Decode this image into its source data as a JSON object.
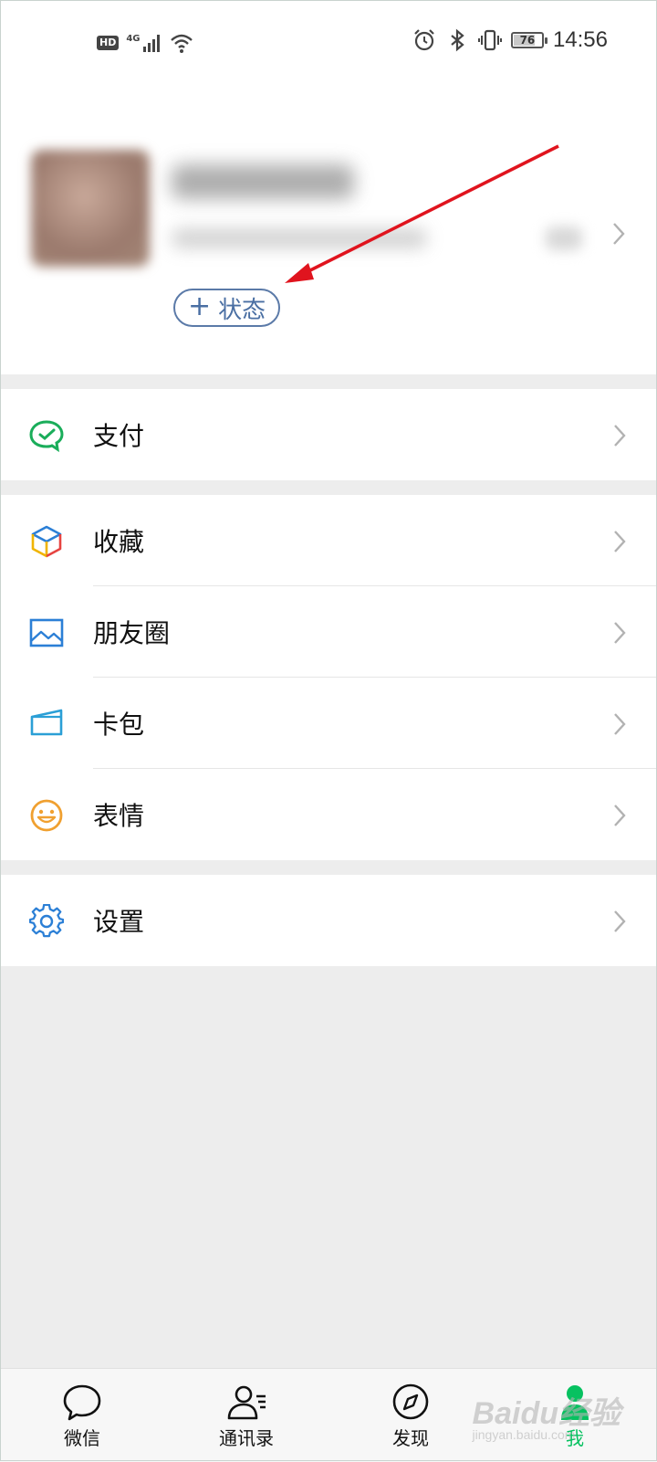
{
  "status_bar": {
    "hd": "HD",
    "network": "4G",
    "battery_level": "76",
    "battery_fraction": 0.76,
    "time": "14:56"
  },
  "profile": {
    "status_button_label": "状态",
    "status_button_plus": "+"
  },
  "menu": {
    "pay": {
      "label": "支付",
      "icon": "wechat-pay-icon"
    },
    "favorites": {
      "label": "收藏",
      "icon": "favorites-cube-icon"
    },
    "moments": {
      "label": "朋友圈",
      "icon": "moments-picture-icon"
    },
    "cards": {
      "label": "卡包",
      "icon": "card-wallet-icon"
    },
    "stickers": {
      "label": "表情",
      "icon": "sticker-smile-icon"
    },
    "settings": {
      "label": "设置",
      "icon": "gear-icon"
    }
  },
  "tabs": [
    {
      "label": "微信",
      "icon": "chat-bubble-icon",
      "active": false
    },
    {
      "label": "通讯录",
      "icon": "contacts-icon",
      "active": false
    },
    {
      "label": "发现",
      "icon": "compass-icon",
      "active": false
    },
    {
      "label": "我",
      "icon": "person-icon",
      "active": true
    }
  ],
  "watermark": {
    "text": "Baidu经验",
    "sub": "jingyan.baidu.com"
  },
  "colors": {
    "accent_green": "#07c160",
    "status_button_blue": "#4a6fa3",
    "annotation_arrow_red": "#e0141e",
    "background": "#ededed"
  }
}
